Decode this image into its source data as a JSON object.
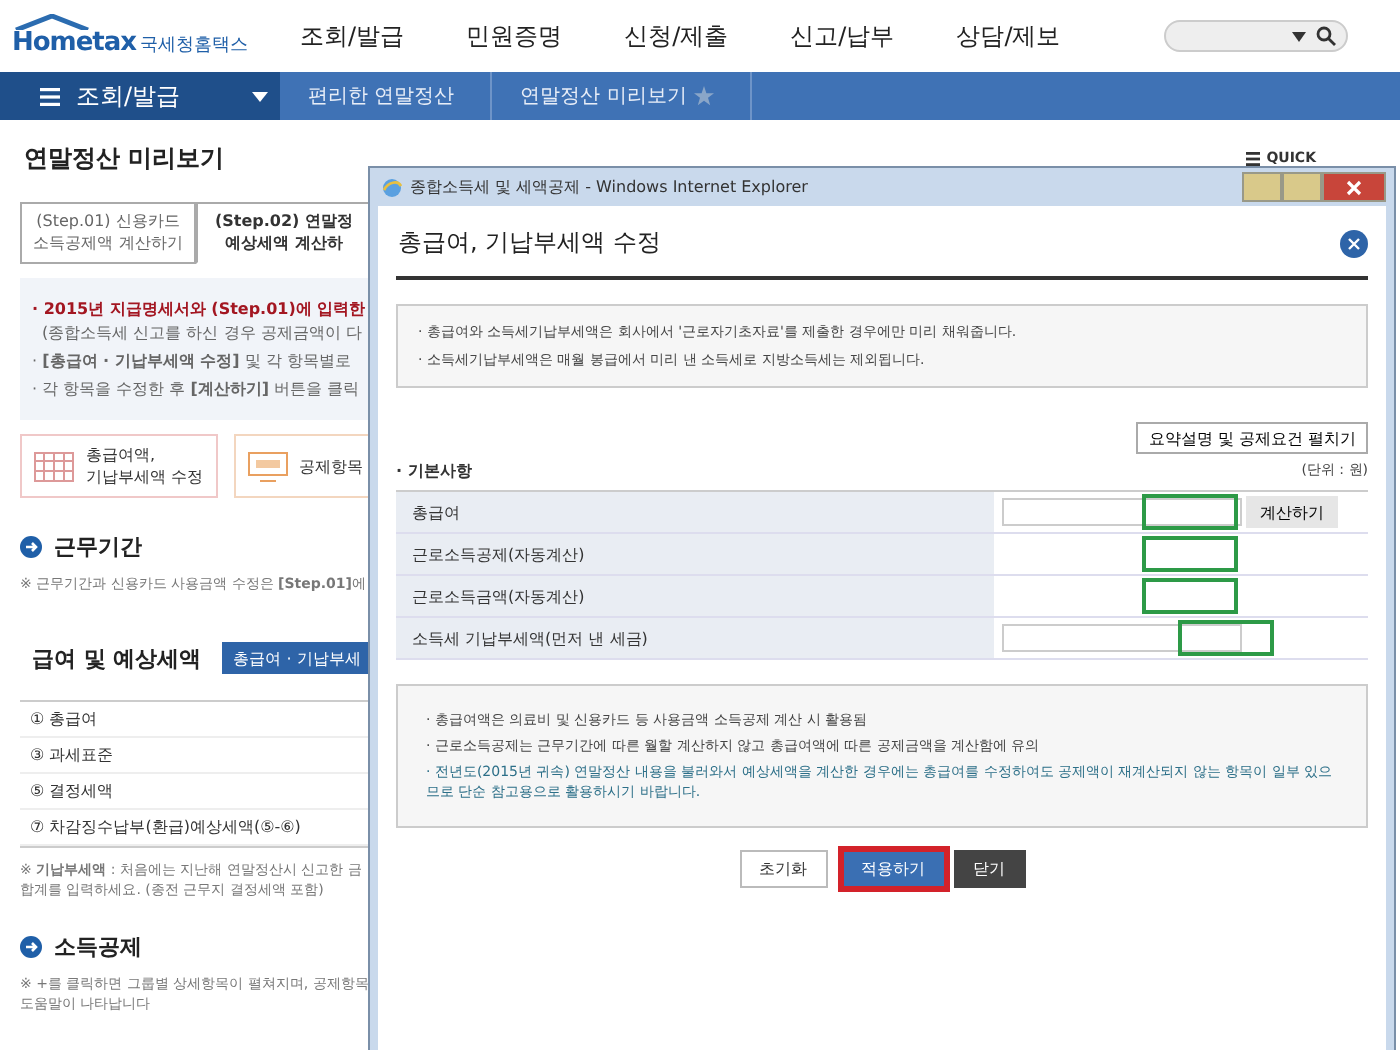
{
  "header": {
    "logo": "Hometax",
    "logo_sub": "국세청홈택스",
    "nav": [
      "조회/발급",
      "민원증명",
      "신청/제출",
      "신고/납부",
      "상담/제보"
    ]
  },
  "menu_bar": {
    "menu": "조회/발급",
    "breadcrumbs": [
      "편리한 연말정산",
      "연말정산 미리보기"
    ]
  },
  "page": {
    "title": "연말정산 미리보기",
    "quick": "QUICK",
    "steps": [
      {
        "lines": [
          "(Step.01) 신용카드",
          "소득공제액 계산하기"
        ],
        "selected": false
      },
      {
        "lines": [
          "(Step.02) 연말정",
          "예상세액 계산하"
        ],
        "selected": true
      }
    ],
    "notice": [
      {
        "text": "· 2015년 지급명세서와 (Step.01)에 입력한",
        "kind": "alert"
      },
      {
        "text": "(종합소득세 신고를 하신 경우 공제금액이 다",
        "kind": "continuation"
      },
      {
        "text": "· **[총급여 · 기납부세액 수정]** 및 각 항목별로",
        "kind": "bullet"
      },
      {
        "text": "· 각 항목을 수정한 후 **[계산하기]** 버튼을 클릭",
        "kind": "bullet"
      }
    ],
    "actions": [
      {
        "lines": [
          "총급여액,",
          "기납부세액 수정"
        ],
        "kind": "calendar"
      },
      {
        "lines": [
          "공제항목"
        ],
        "kind": "monitor"
      }
    ],
    "work_period": {
      "title": "근무기간",
      "note": "※ 근무기간과 신용카드 사용금액 수정은 **[Step.01]**에"
    },
    "salary": {
      "title": "급여 및 예상세액",
      "button": "총급여 · 기납부세",
      "rows": [
        "① 총급여",
        "③ 과세표준",
        "⑤ 결정세액",
        "⑦ 차감징수납부(환급)예상세액(⑤-⑥)"
      ],
      "note": [
        "※ **기납부세액** : 처음에는 지난해 연말정산시 신고한 금",
        "합계를 입력하세요. (종전 근무지 결정세액 포함)"
      ]
    },
    "deduction": {
      "title": "소득공제",
      "note": [
        "※ +를 클릭하면 그룹별 상세항목이 펼쳐지며, 공제항목",
        "도움말이 나타납니다"
      ]
    }
  },
  "popup": {
    "window_title": "종합소득세 및 세액공제 - Windows Internet Explorer",
    "heading": "총급여, 기납부세액 수정",
    "info": [
      "· 총급여와 소득세기납부세액은 회사에서 '근로자기초자료'를 제출한 경우에만 미리 채워줍니다.",
      "· 소득세기납부세액은 매월 봉급에서 미리 낸 소득세로 지방소득세는 제외됩니다."
    ],
    "expand_button": "요약설명 및 공제요건 펼치기",
    "section_label": "· 기본사항",
    "unit": "(단위 : 원)",
    "rows": [
      {
        "label": "총급여",
        "kind": "input_button",
        "button": "계산하기",
        "highlighted": true
      },
      {
        "label": "근로소득공제(자동계산)",
        "kind": "auto",
        "highlighted": true
      },
      {
        "label": "근로소득금액(자동계산)",
        "kind": "auto",
        "highlighted": true
      },
      {
        "label": "소득세 기납부세액(먼저 낸 세금)",
        "kind": "input",
        "highlighted": true
      }
    ],
    "notes": [
      {
        "text": "· 총급여액은 의료비 및 신용카드 등 사용금액 소득공제 계산 시 활용됨",
        "kind": "plain"
      },
      {
        "text": "· 근로소득공제는 근무기간에 따른 월할 계산하지 않고 총급여액에 따른 공제금액을 계산함에 유의",
        "kind": "plain"
      },
      {
        "text": "· 전년도(2015년 귀속) 연말정산 내용을 불러와서 예상세액을 계산한 경우에는 총급여를 수정하여도 공제액이 재계산되지 않는 항목이 일부 있으므로 단순 참고용으로 활용하시기 바랍니다.",
        "kind": "accent"
      }
    ],
    "buttons": [
      {
        "label": "초기화",
        "kind": "reset",
        "highlighted": false
      },
      {
        "label": "적용하기",
        "kind": "primary",
        "highlighted": true
      },
      {
        "label": "닫기",
        "kind": "dark",
        "highlighted": false
      }
    ]
  }
}
